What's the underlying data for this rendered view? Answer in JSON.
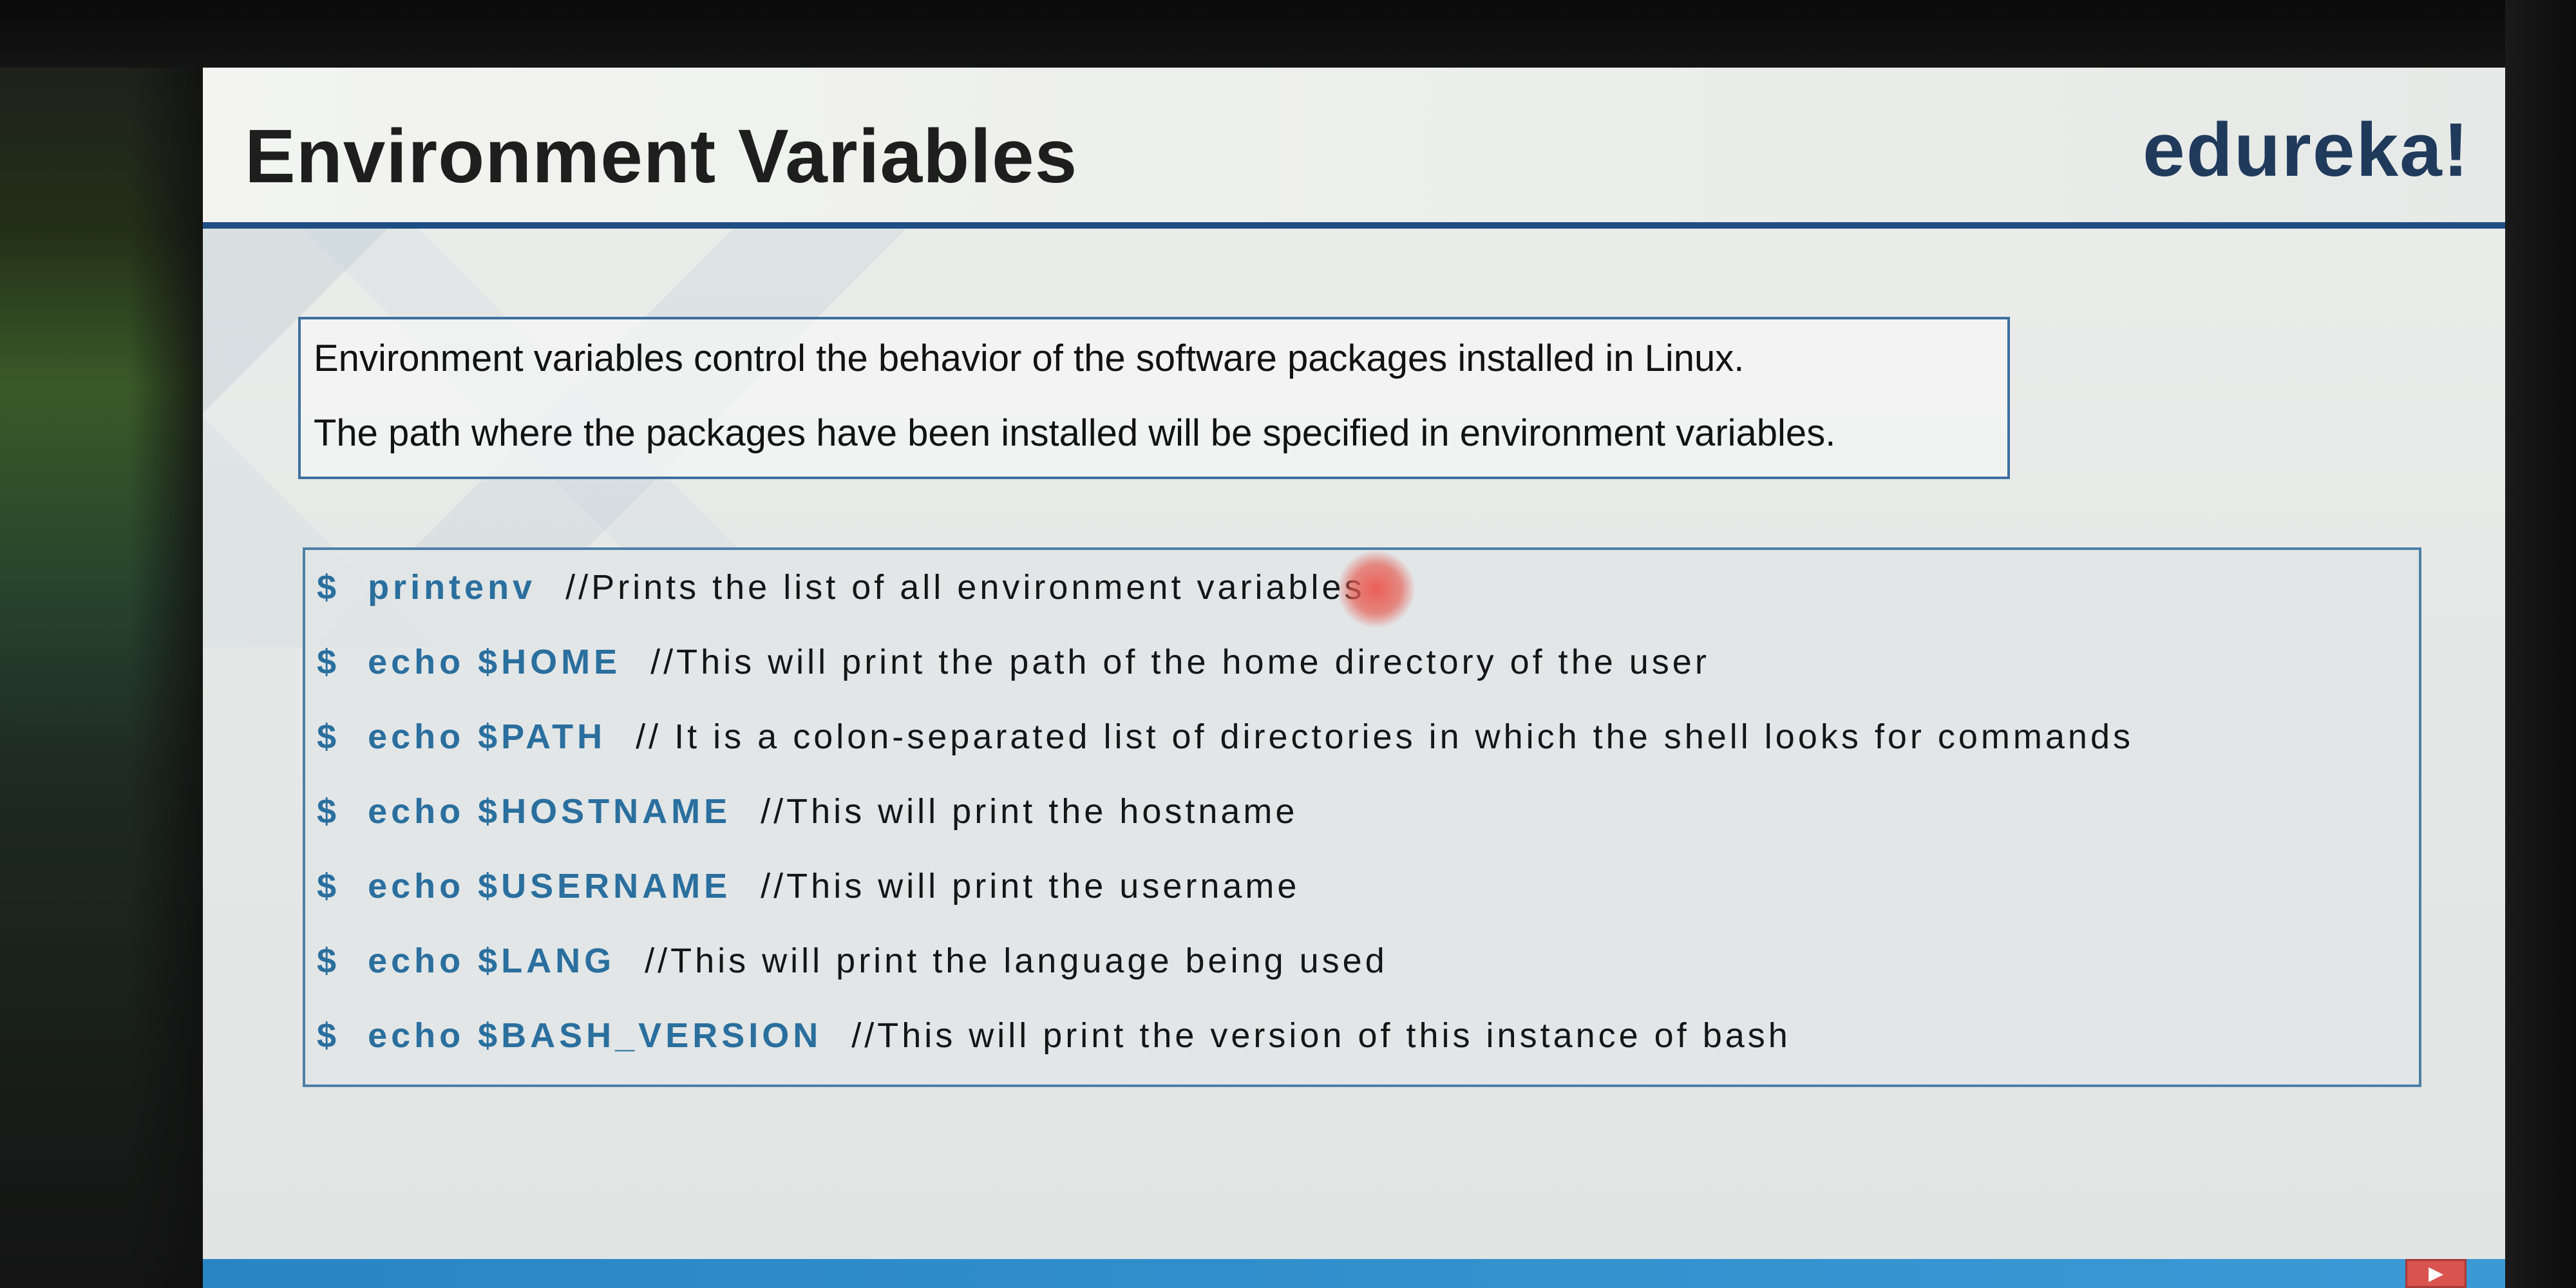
{
  "slide": {
    "title": "Environment Variables",
    "brand": "edureka!",
    "intro": [
      "Environment variables control the behavior of the software packages installed in Linux.",
      "The path where the packages have been installed will be specified in environment variables."
    ],
    "commands": [
      {
        "prompt": "$",
        "cmd": "printenv",
        "comment": "//Prints the list of all environment variables"
      },
      {
        "prompt": "$",
        "cmd": "echo $HOME",
        "comment": "//This will print the path of the home directory of the user"
      },
      {
        "prompt": "$",
        "cmd": "echo $PATH",
        "comment": "// It is a colon-separated list of directories in which the shell looks for commands"
      },
      {
        "prompt": "$",
        "cmd": "echo $HOSTNAME",
        "comment": "//This will print the hostname"
      },
      {
        "prompt": "$",
        "cmd": "echo $USERNAME",
        "comment": "//This will print the username"
      },
      {
        "prompt": "$",
        "cmd": "echo $LANG",
        "comment": "//This will print the language being used"
      },
      {
        "prompt": "$",
        "cmd": "echo $BASH_VERSION",
        "comment": "//This will print the version of this instance of bash"
      }
    ],
    "play_icon": "play-icon"
  },
  "colors": {
    "title_rule": "#1f4e82",
    "command": "#2a6f9e",
    "brand": "#203a5c"
  }
}
